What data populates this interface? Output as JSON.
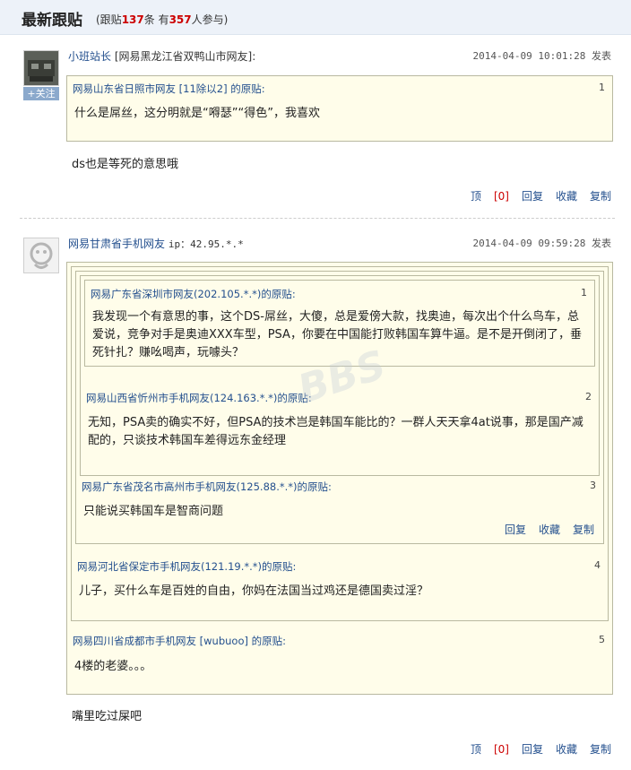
{
  "header": {
    "title": "最新跟贴",
    "stats_open": "(跟贴",
    "reply_count": "137",
    "stats_mid": "条 有",
    "participants": "357",
    "stats_close": "人参与)"
  },
  "posts": [
    {
      "author": "小班站长",
      "location": "[网易黑龙江省双鸭山市网友]:",
      "time": "2014-04-09 10:01:28 发表",
      "follow_label": "+关注",
      "quote": {
        "head": "网易山东省日照市网友 [11除以2] 的原贴:",
        "index": "1",
        "text": "什么是屌丝，这分明就是“嘚瑟”“得色”，我喜欢"
      },
      "reply": "ds也是等死的意思哦",
      "actions": {
        "up": "顶",
        "up_count": "[0]",
        "reply": "回复",
        "fav": "收藏",
        "copy": "复制"
      }
    },
    {
      "author": "网易甘肃省手机网友",
      "location": "ip：42.95.*.*",
      "time": "2014-04-09 09:59:28 发表",
      "quotes": [
        {
          "head": "网易广东省深圳市网友(202.105.*.*)的原贴:",
          "index": "1",
          "text": "我发现一个有意思的事，这个DS-屌丝，大傻，总是爱傍大款，找奥迪，每次出个什么鸟车，总爱说，竞争对手是奥迪XXX车型，PSA，你要在中国能打败韩国车算牛逼。是不是开倒闭了，垂死针扎？赚吆喝声，玩噱头？"
        },
        {
          "head": "网易山西省忻州市手机网友(124.163.*.*)的原贴:",
          "index": "2",
          "text": "无知，PSA卖的确实不好，但PSA的技术岂是韩国车能比的？一群人天天拿4at说事，那是国产减配的，只谈技术韩国车差得远东金经理"
        },
        {
          "head": "网易广东省茂名市高州市手机网友(125.88.*.*)的原贴:",
          "index": "3",
          "text": "只能说买韩国车是智商问题"
        },
        {
          "head": "网易河北省保定市手机网友(121.19.*.*)的原贴:",
          "index": "4",
          "text": "儿子，买什么车是百姓的自由，你妈在法国当过鸡还是德国卖过淫？"
        },
        {
          "head": "网易四川省成都市手机网友 [wubuoo] 的原贴:",
          "index": "5",
          "text": "4楼的老婆。。。"
        }
      ],
      "inner_actions": {
        "reply": "回复",
        "fav": "收藏",
        "copy": "复制"
      },
      "reply": "嘴里吃过屎吧",
      "actions": {
        "up": "顶",
        "up_count": "[0]",
        "reply": "回复",
        "fav": "收藏",
        "copy": "复制"
      }
    }
  ]
}
